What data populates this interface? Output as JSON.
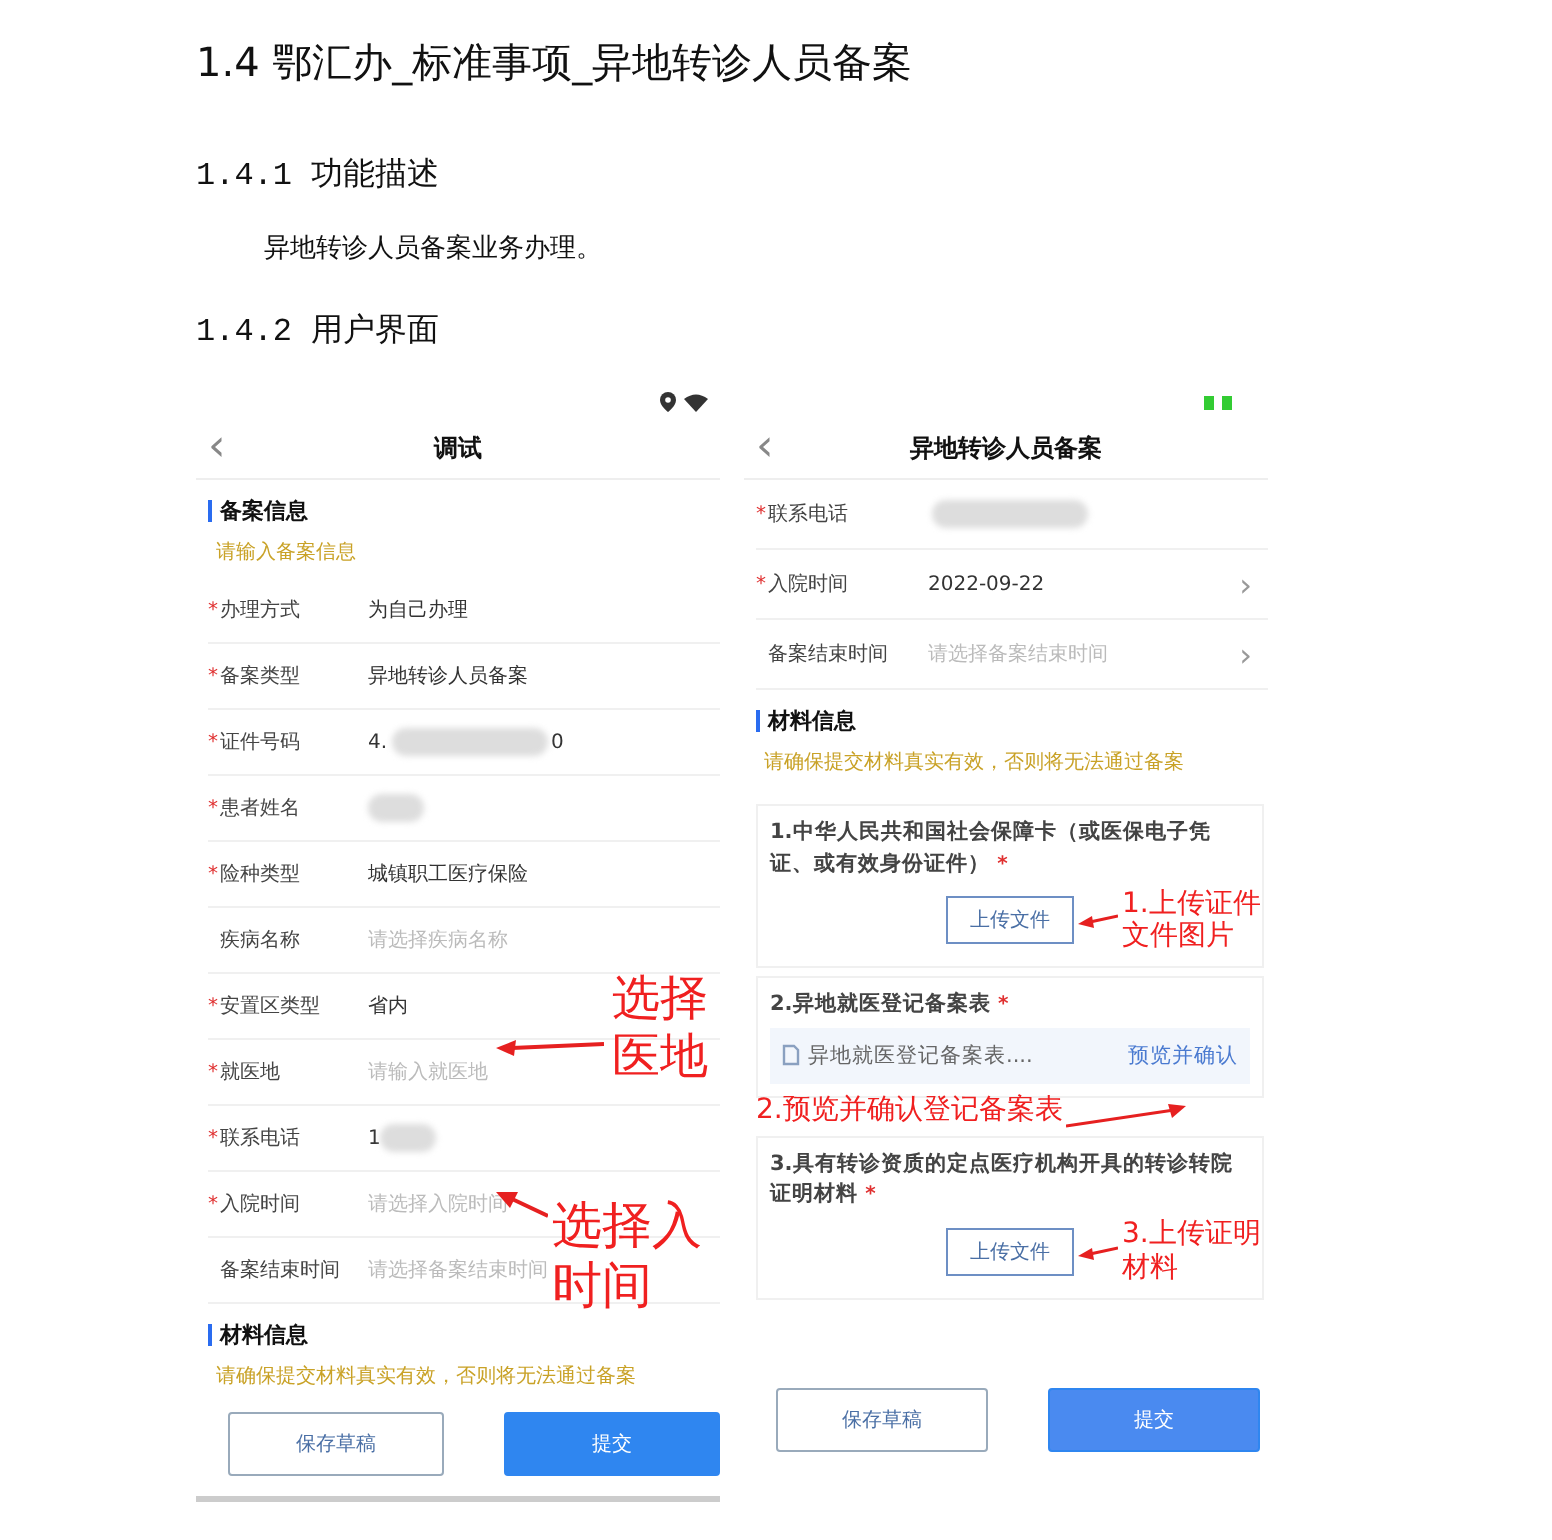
{
  "heading": "1.4 鄂汇办_标准事项_异地转诊人员备案",
  "section_1": {
    "title": "1.4.1 功能描述",
    "paragraph": "异地转诊人员备案业务办理。"
  },
  "section_2": {
    "title": "1.4.2 用户界面"
  },
  "phone_left": {
    "title": "调试",
    "back": "‹",
    "section_1": {
      "title": "备案信息",
      "hint": "请输入备案信息"
    },
    "fields": [
      {
        "label": "办理方式",
        "mark": "*",
        "value": "为自己办理"
      },
      {
        "label": "备案类型",
        "mark": "*",
        "value": "异地转诊人员备案"
      },
      {
        "label": "证件号码",
        "mark": "*",
        "value": "4.",
        "redacted": true,
        "value_end": "0"
      },
      {
        "label": "患者姓名",
        "mark": "*",
        "redacted": true
      },
      {
        "label": "险种类型",
        "mark": "*",
        "value": "城镇职工医疗保险"
      },
      {
        "label": "疾病名称",
        "placeholder": "请选择疾病名称"
      },
      {
        "label": "安置区类型",
        "mark": "*",
        "value": "省内"
      },
      {
        "label": "就医地",
        "mark": "*",
        "placeholder": "请输入就医地"
      },
      {
        "label": "联系电话",
        "mark": "*",
        "value": "1",
        "redacted": true
      },
      {
        "label": "入院时间",
        "mark": "*",
        "placeholder": "请选择入院时间"
      },
      {
        "label": "备案结束时间",
        "placeholder": "请选择备案结束时间"
      }
    ],
    "section_2": {
      "title": "材料信息",
      "hint": "请确保提交材料真实有效，否则将无法通过备案"
    },
    "buttons": [
      {
        "label": "保存草稿",
        "kind": "outline"
      },
      {
        "label": "提交",
        "kind": "primary"
      }
    ],
    "annotations": [
      {
        "lines": [
          "选择",
          "医地"
        ]
      },
      {
        "lines": [
          "选择入",
          "时间"
        ]
      }
    ]
  },
  "phone_right": {
    "title": "异地转诊人员备案",
    "back": "‹",
    "fields": [
      {
        "label": "联系电话",
        "mark": "*",
        "redacted": true
      },
      {
        "label": "入院时间",
        "mark": "*",
        "value": "2022-09-22",
        "chevron": "›"
      },
      {
        "label": "备案结束时间",
        "placeholder": "请选择备案结束时间",
        "chevron": "›"
      }
    ],
    "section": {
      "title": "材料信息",
      "hint": "请确保提交材料真实有效，否则将无法通过备案"
    },
    "materials": [
      {
        "title": "1.中华人民共和国社会保障卡（或医保电子凭证、或有效身份证件）",
        "mark": "*",
        "kind": "upload",
        "button": "上传文件"
      },
      {
        "title": "2.异地就医登记备案表",
        "mark": "*",
        "kind": "file",
        "file": "异地就医登记备案表....",
        "link": "预览并确认"
      },
      {
        "title": "3.具有转诊资质的定点医疗机构开具的转诊转院证明材料",
        "mark": "*",
        "kind": "upload",
        "button": "上传文件"
      }
    ],
    "buttons": [
      {
        "label": "保存草稿",
        "kind": "outline"
      },
      {
        "label": "提交",
        "kind": "primary"
      }
    ],
    "annotations": [
      {
        "lines": [
          "1.上传证件",
          "文件图片"
        ]
      },
      {
        "lines": [
          "2.预览并确认登记备案表"
        ]
      },
      {
        "lines": [
          "3.上传证明",
          "材料"
        ]
      }
    ]
  }
}
